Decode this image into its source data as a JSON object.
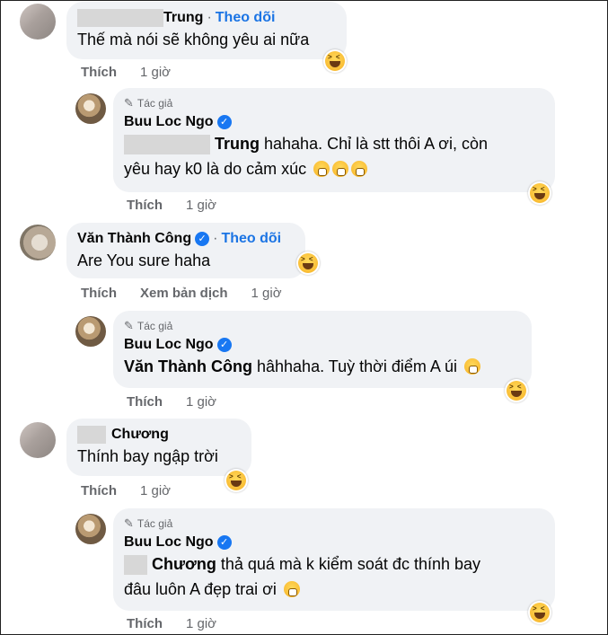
{
  "thread": {
    "c1": {
      "name": "Trung",
      "follow": "Theo dõi",
      "text": "Thế mà nói sẽ không yêu ai nữa",
      "like": "Thích",
      "time": "1 giờ"
    },
    "r1": {
      "author_label": "Tác giả",
      "name": "Buu Loc Ngo",
      "tag": "Trung",
      "text_line1": " hahaha. Chỉ là stt thôi A ơi, còn",
      "text_line2": "yêu hay k0 là do cảm xúc",
      "like": "Thích",
      "time": "1 giờ"
    },
    "c2": {
      "name": "Văn Thành Công",
      "follow": "Theo dõi",
      "text": "Are You sure haha",
      "like": "Thích",
      "translate": "Xem bản dịch",
      "time": "1 giờ"
    },
    "r2": {
      "author_label": "Tác giả",
      "name": "Buu Loc Ngo",
      "tag": "Văn Thành Công",
      "text": " hâhhaha. Tuỳ thời điểm A úi",
      "like": "Thích",
      "time": "1 giờ"
    },
    "c3": {
      "name": "Chương",
      "text": "Thính bay ngập trời",
      "like": "Thích",
      "time": "1 giờ"
    },
    "r3": {
      "author_label": "Tác giả",
      "name": "Buu Loc Ngo",
      "tag": "Chương",
      "text_line1": " thả quá mà k kiểm soát đc thính bay",
      "text_line2": "đâu luôn A đẹp trai ơi",
      "like": "Thích",
      "time": "1 giờ"
    }
  },
  "icons": {
    "verified": "verified-badge-icon",
    "author": "pen-icon",
    "reaction": "haha-reaction-icon",
    "emoji": "astonished-emoji-icon"
  },
  "colors": {
    "bubble": "#f0f2f5",
    "link": "#1b74e4",
    "meta": "#65676b",
    "verified": "#1877f2"
  }
}
